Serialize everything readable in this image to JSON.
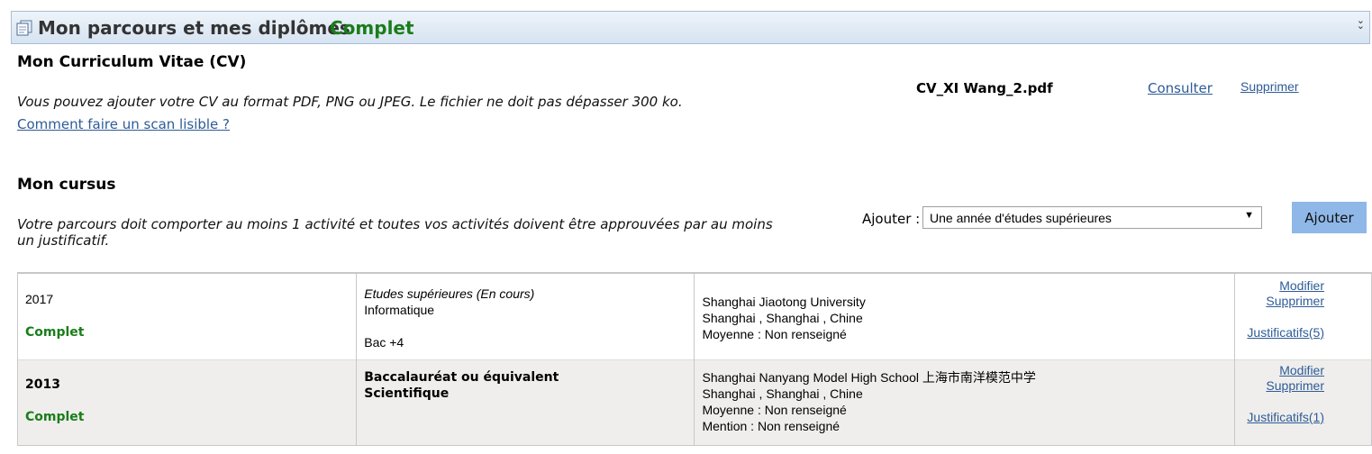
{
  "header": {
    "title": "Mon parcours et mes diplômes",
    "status": "Complet",
    "collapse_icon": "double-chevron-down-icon"
  },
  "cv": {
    "heading": "Mon Curriculum Vitae (CV)",
    "instructions": "Vous pouvez ajouter votre CV au format PDF, PNG ou JPEG. Le fichier ne doit pas dépasser 300 ko.",
    "scan_help_link": "Comment faire un scan lisible ?",
    "file_name": "CV_XI Wang_2.pdf",
    "consult_link": "Consulter",
    "delete_link": "Supprimer"
  },
  "cursus": {
    "heading": "Mon cursus",
    "instructions": "Votre parcours doit comporter au moins 1 activité et toutes vos activités doivent être approuvées par au moins un justificatif.",
    "add_label": "Ajouter :",
    "add_select_value": "Une année d'études supérieures",
    "add_button": "Ajouter",
    "rows": [
      {
        "year": "2017",
        "status": "Complet",
        "type": "Etudes supérieures (En cours)",
        "field": "Informatique",
        "level": "Bac +4",
        "school": "Shanghai Jiaotong University",
        "location": "Shanghai , Shanghai , Chine",
        "average": "Moyenne : Non renseigné",
        "modify": "Modifier",
        "delete": "Supprimer",
        "justifs": "Justificatifs(5)"
      },
      {
        "year": "2013",
        "status": "Complet",
        "type": "Baccalauréat ou équivalent",
        "field": "Scientifique",
        "school": "Shanghai Nanyang Model High School 上海市南洋模范中学",
        "location": "Shanghai , Shanghai , Chine",
        "average": "Moyenne : Non renseigné",
        "mention": "Mention : Non renseigné",
        "modify": "Modifier",
        "delete": "Supprimer",
        "justifs": "Justificatifs(1)"
      }
    ]
  },
  "colors": {
    "status_green": "#1a7d1a",
    "link_blue": "#2e5c97",
    "button_blue": "#8fb8e8",
    "header_border": "#a9bfd6"
  }
}
